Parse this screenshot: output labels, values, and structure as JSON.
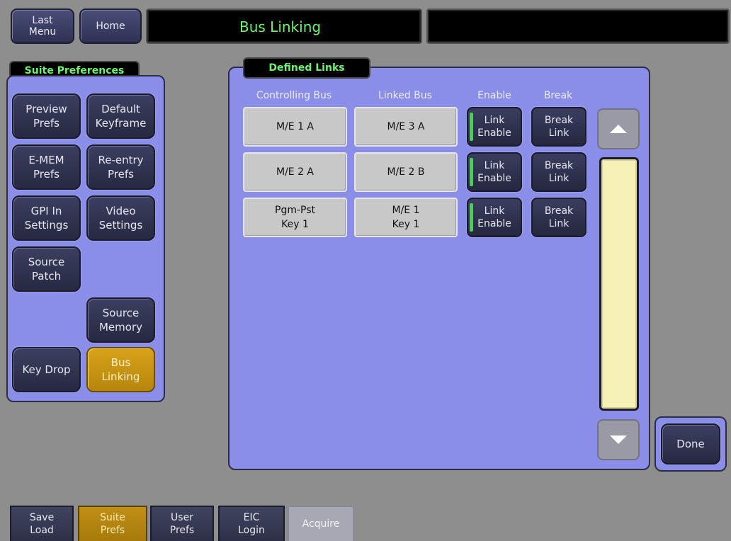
{
  "header": {
    "last_menu": "Last\nMenu",
    "home": "Home",
    "title": "Bus Linking",
    "secondary": ""
  },
  "suite_prefs": {
    "tab_label": "Suite Preferences",
    "buttons": [
      {
        "label": "Preview\nPrefs"
      },
      {
        "label": "Default\nKeyframe"
      },
      {
        "label": "E-MEM\nPrefs"
      },
      {
        "label": "Re-entry\nPrefs"
      },
      {
        "label": "GPI In\nSettings"
      },
      {
        "label": "Video\nSettings"
      },
      {
        "label": "Source\nPatch"
      },
      {
        "label": "Source\nMemory"
      },
      {
        "label": "Key Drop"
      },
      {
        "label": "Bus\nLinking"
      }
    ]
  },
  "defined_links": {
    "tab_label": "Defined Links",
    "columns": [
      "Controlling Bus",
      "Linked Bus",
      "Enable",
      "Break"
    ],
    "rows": [
      {
        "controlling": "M/E 1 A",
        "linked": "M/E 3 A",
        "enable": "Link\nEnable",
        "break": "Break\nLink"
      },
      {
        "controlling": "M/E 2 A",
        "linked": "M/E 2 B",
        "enable": "Link\nEnable",
        "break": "Break\nLink"
      },
      {
        "controlling": "Pgm-Pst\nKey 1",
        "linked": "M/E 1\nKey 1",
        "enable": "Link\nEnable",
        "break": "Break\nLink"
      }
    ]
  },
  "done": "Done",
  "bottom_tabs": [
    {
      "label": "Save\nLoad"
    },
    {
      "label": "Suite\nPrefs"
    },
    {
      "label": "User\nPrefs"
    },
    {
      "label": "EIC\nLogin"
    },
    {
      "label": "Acquire"
    }
  ],
  "colors": {
    "panel": "#8a8ee8",
    "accent_green": "#6cf56c",
    "active_amber": "#c8931a"
  }
}
